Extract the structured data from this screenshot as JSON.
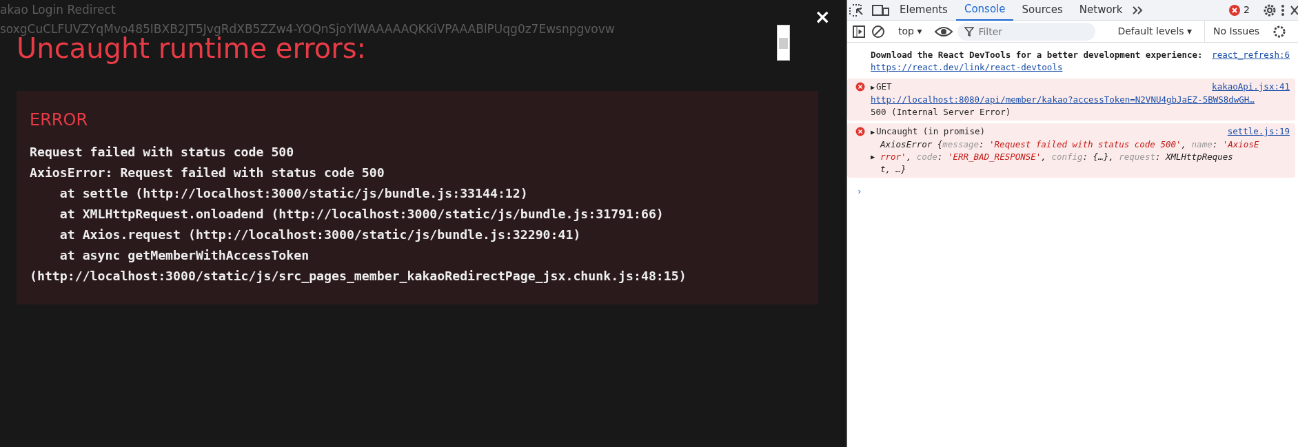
{
  "page_behind": {
    "lines": [
      "akao Login Redirect",
      "soxgCuCLFUVZYqMvo485IBXB2JT5JvgRdXB5ZZw4-YOQnSjoYlWAAAAAQKKiVPAAABlPUqg0z7Ewsnpgvovw"
    ]
  },
  "overlay": {
    "title": "Uncaught runtime errors:",
    "close": "×",
    "error": {
      "label": "ERROR",
      "lines": [
        "Request failed with status code 500",
        "AxiosError: Request failed with status code 500",
        "    at settle (http://localhost:3000/static/js/bundle.js:33144:12)",
        "    at XMLHttpRequest.onloadend (http://localhost:3000/static/js/bundle.js:31791:66)",
        "    at Axios.request (http://localhost:3000/static/js/bundle.js:32290:41)",
        "    at async getMemberWithAccessToken",
        "(http://localhost:3000/static/js/src_pages_member_kakaoRedirectPage_jsx.chunk.js:48:15)"
      ]
    }
  },
  "devtools": {
    "tabs": [
      {
        "label": "Elements",
        "selected": false
      },
      {
        "label": "Console",
        "selected": true
      },
      {
        "label": "Sources",
        "selected": false
      },
      {
        "label": "Network",
        "selected": false
      }
    ],
    "error_count": "2",
    "toolbar": {
      "context": "top ▾",
      "filter_placeholder": "Filter",
      "levels": "Default levels ▾",
      "issues": "No Issues"
    },
    "prompt": "›",
    "messages": [
      {
        "kind": "info",
        "source": "react_refresh:6",
        "text": "Download the React DevTools for a better development experience:",
        "link": "https://react.dev/link/react-devtools"
      },
      {
        "kind": "error",
        "source": "kakaoApi.jsx:41",
        "toggle": "▶",
        "text": "GET",
        "link": "http://localhost:8080/api/member/kakao?accessToken=N2VNU4gbJaEZ-5BWS8dwGH…",
        "detail": "500 (Internal Server Error)"
      },
      {
        "kind": "error",
        "source": "settle.js:19",
        "toggle": "▶",
        "text": "Uncaught (in promise)",
        "preview_toggle": "▶",
        "preview": [
          [
            {
              "kind": "plain",
              "text": "AxiosError {"
            },
            {
              "kind": "key",
              "text": "message"
            },
            {
              "kind": "plain",
              "text": ": "
            },
            {
              "kind": "string",
              "text": "'Request failed with status code 500'"
            },
            {
              "kind": "plain",
              "text": ", "
            },
            {
              "kind": "key",
              "text": "name"
            },
            {
              "kind": "plain",
              "text": ": "
            },
            {
              "kind": "string",
              "text": "'AxiosE"
            }
          ],
          [
            {
              "kind": "string",
              "text": "rror'"
            },
            {
              "kind": "plain",
              "text": ", "
            },
            {
              "kind": "key",
              "text": "code"
            },
            {
              "kind": "plain",
              "text": ": "
            },
            {
              "kind": "string",
              "text": "'ERR_BAD_RESPONSE'"
            },
            {
              "kind": "plain",
              "text": ", "
            },
            {
              "kind": "key",
              "text": "config"
            },
            {
              "kind": "plain",
              "text": ": {…}, "
            },
            {
              "kind": "key",
              "text": "request"
            },
            {
              "kind": "plain",
              "text": ": XMLHttpReques"
            }
          ],
          [
            {
              "kind": "plain",
              "text": "t, …}"
            }
          ]
        ]
      }
    ]
  }
}
